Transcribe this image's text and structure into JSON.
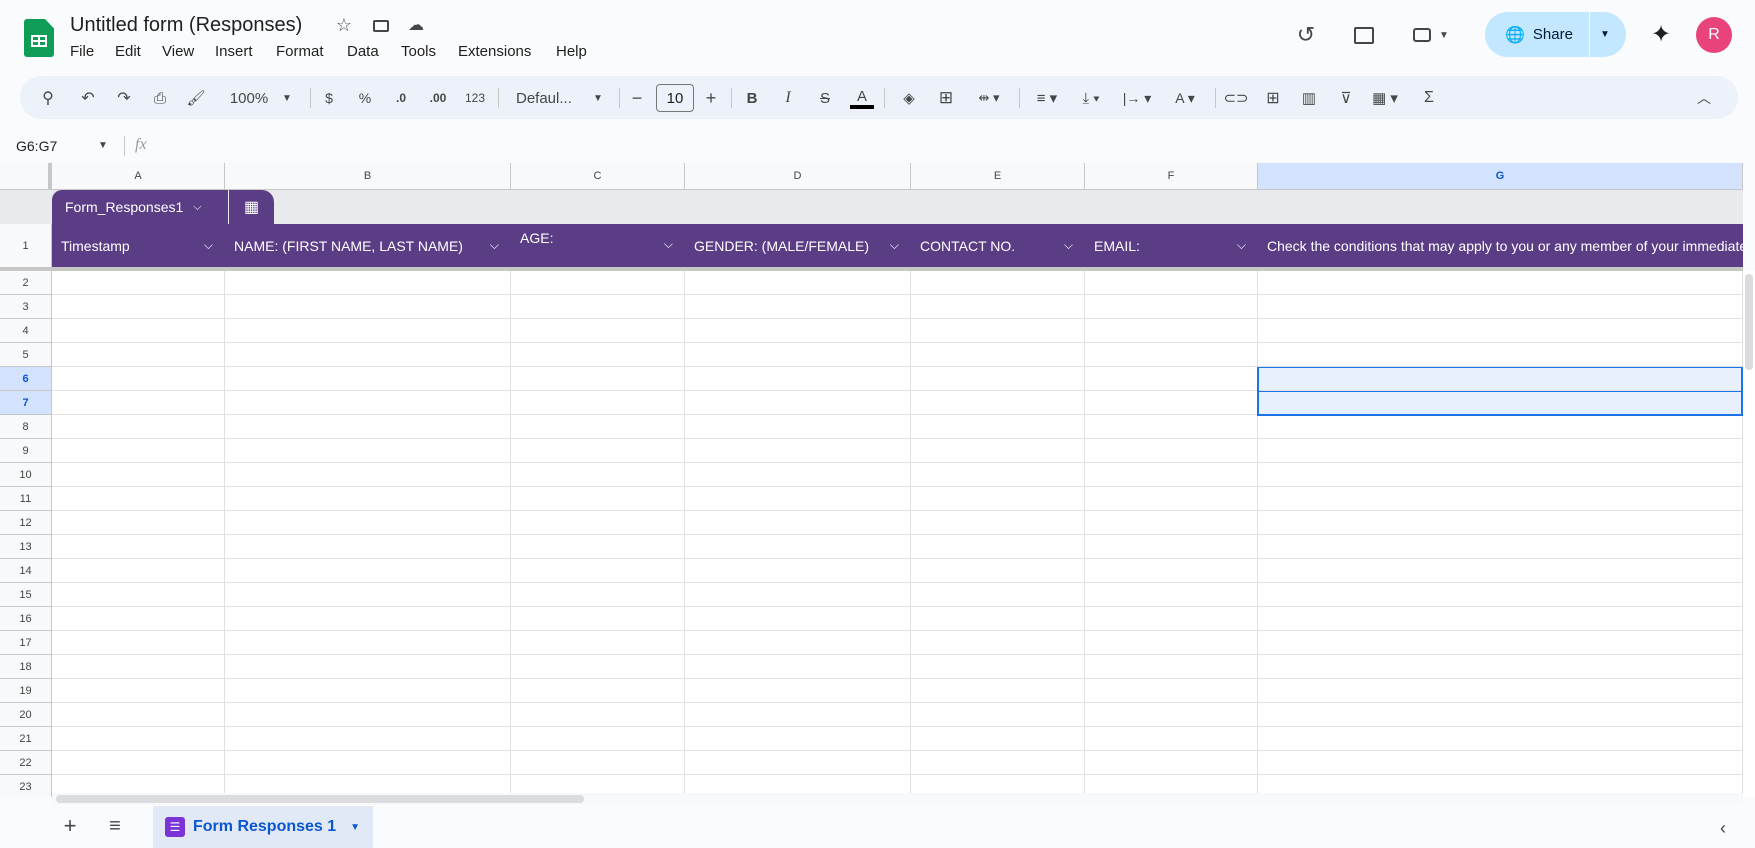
{
  "app": {
    "title": "Untitled form (Responses)",
    "menus": [
      "File",
      "Edit",
      "View",
      "Insert",
      "Format",
      "Data",
      "Tools",
      "Extensions",
      "Help"
    ],
    "share_label": "Share",
    "avatar_initial": "R",
    "brand_color": "#0f9d58",
    "accent": "#5b3d86"
  },
  "toolbar": {
    "zoom": "100%",
    "currency": "$",
    "percent": "%",
    "dec_decrease": ".0",
    "dec_increase": ".00",
    "number_format": "123",
    "font": "Defaul...",
    "font_size": "10",
    "bold": "B",
    "italic": "I",
    "sum": "Σ"
  },
  "formula_bar": {
    "name_box": "G6:G7",
    "fx": "fx",
    "value": ""
  },
  "columns": [
    "A",
    "B",
    "C",
    "D",
    "E",
    "F",
    "G"
  ],
  "table": {
    "name": "Form_Responses1",
    "headers": [
      "Timestamp",
      "NAME: (FIRST NAME, LAST NAME)",
      "AGE:",
      "GENDER: (MALE/FEMALE)",
      "CONTACT NO.",
      "EMAIL:",
      "Check the conditions that may apply to you or any member of your immediate"
    ]
  },
  "rows": [
    "1",
    "2",
    "3",
    "4",
    "5",
    "6",
    "7",
    "8",
    "9",
    "10",
    "11",
    "12",
    "13",
    "14",
    "15",
    "16",
    "17",
    "18",
    "19",
    "20",
    "21",
    "22",
    "23"
  ],
  "selection": {
    "range": "G6:G7",
    "rows": [
      6,
      7
    ],
    "column": "G"
  },
  "sheets": [
    {
      "label": "Form Responses 1",
      "active": true
    }
  ]
}
